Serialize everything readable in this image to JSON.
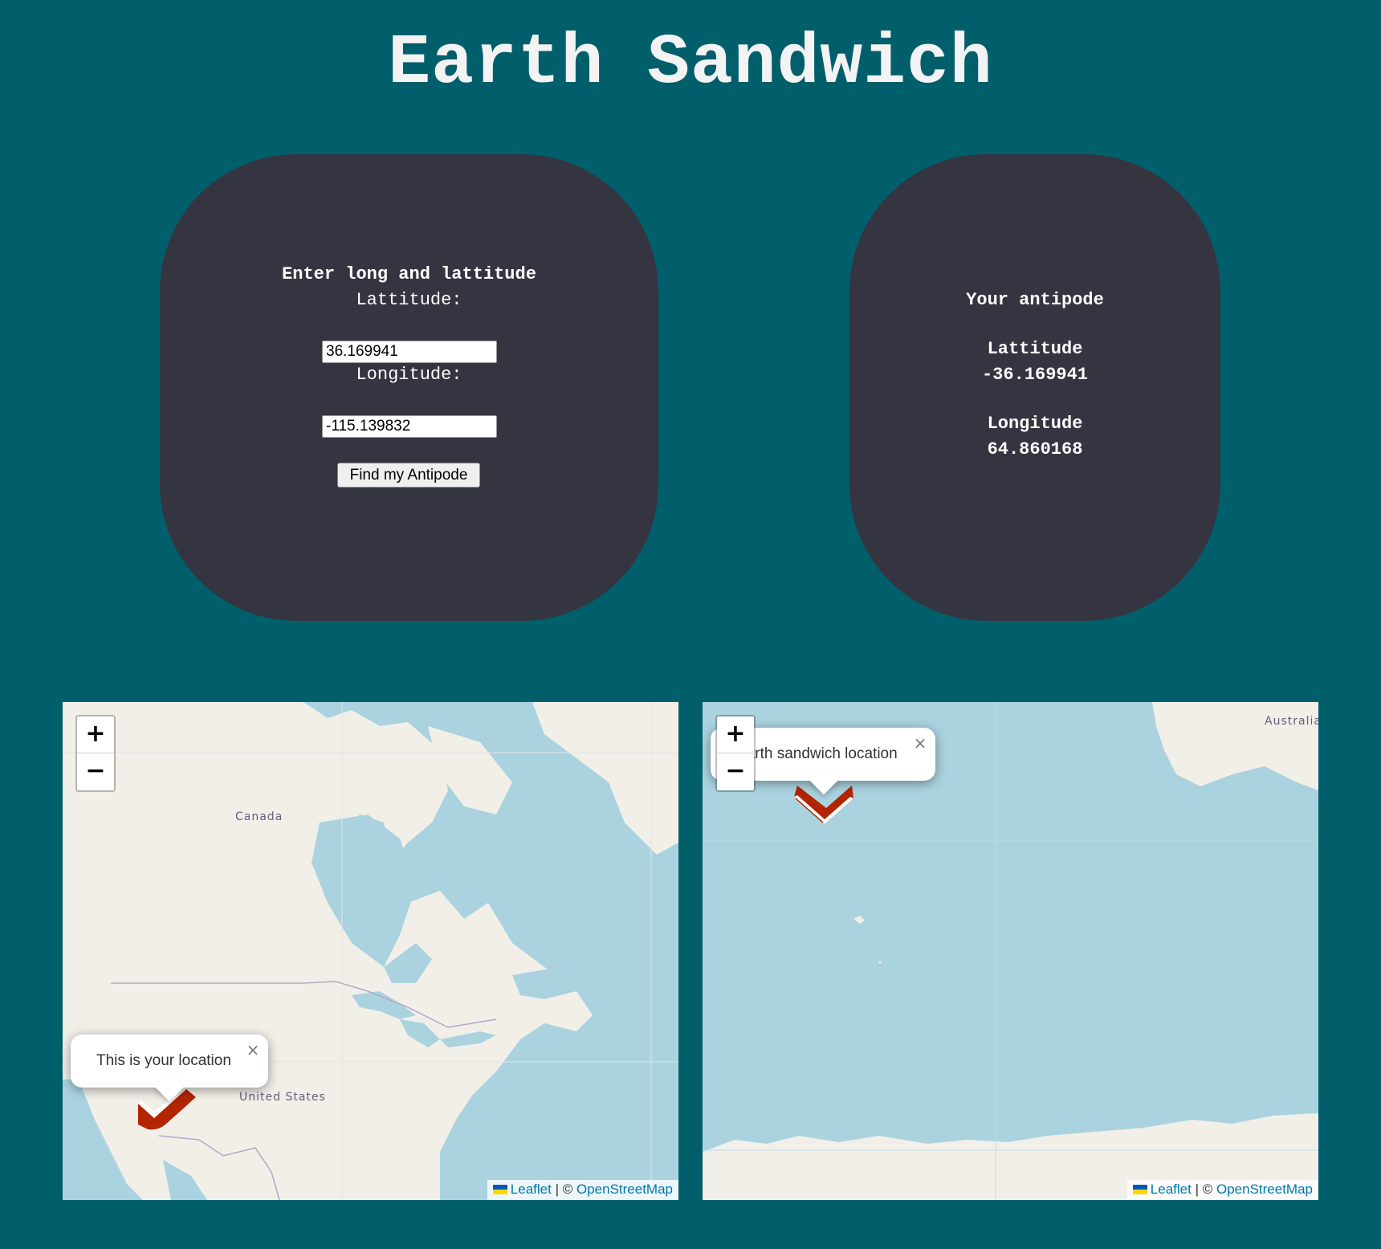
{
  "page": {
    "title": "Earth Sandwich"
  },
  "input_card": {
    "heading": "Enter long and lattitude",
    "latitude_label": "Lattitude:",
    "latitude_value": "36.169941",
    "longitude_label": "Longitude:",
    "longitude_value": "-115.139832",
    "button_label": "Find my Antipode"
  },
  "output_card": {
    "heading": "Your antipode",
    "latitude_label": "Lattitude",
    "latitude_value": "-36.169941",
    "longitude_label": "Longitude",
    "longitude_value": "64.860168"
  },
  "map_user": {
    "zoom_in": "+",
    "zoom_out": "−",
    "popup_text": "This is your location",
    "close_symbol": "×",
    "labels": {
      "canada": "Canada",
      "united_states": "United States"
    },
    "attribution": {
      "leaflet": "Leaflet",
      "separator": "| ©",
      "osm": "OpenStreetMap"
    }
  },
  "map_antipode": {
    "zoom_in": "+",
    "zoom_out": "−",
    "popup_text": "Earth sandwich location",
    "close_symbol": "×",
    "labels": {
      "australia": "Australia"
    },
    "attribution": {
      "leaflet": "Leaflet",
      "separator": "| ©",
      "osm": "OpenStreetMap"
    }
  },
  "colors": {
    "page_background": "#015f6c",
    "card_background": "#343541",
    "water": "#aad3df",
    "land": "#f2efe9",
    "marker": "#b32400",
    "link": "#0078a8"
  },
  "icons": {
    "marker": "sandwich-marker-icon",
    "close": "close-icon",
    "flag": "ukraine-flag-icon"
  }
}
